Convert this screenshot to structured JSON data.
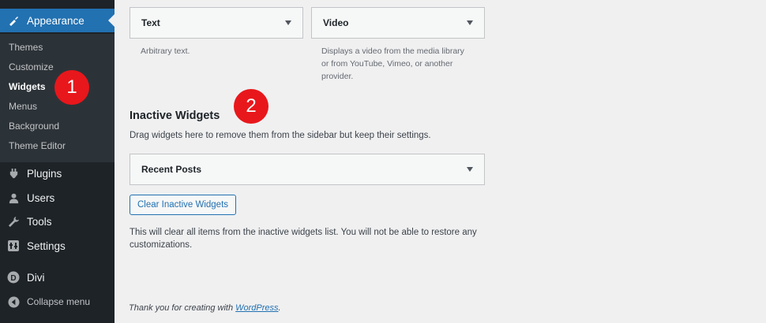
{
  "sidebar": {
    "appearance": {
      "label": "Appearance",
      "icon": "paintbrush-icon"
    },
    "submenu": [
      {
        "label": "Themes"
      },
      {
        "label": "Customize"
      },
      {
        "label": "Widgets"
      },
      {
        "label": "Menus"
      },
      {
        "label": "Background"
      },
      {
        "label": "Theme Editor"
      }
    ],
    "items": [
      {
        "label": "Plugins",
        "icon": "plugin-icon"
      },
      {
        "label": "Users",
        "icon": "user-icon"
      },
      {
        "label": "Tools",
        "icon": "wrench-icon"
      },
      {
        "label": "Settings",
        "icon": "settings-icon"
      },
      {
        "label": "Divi",
        "icon": "divi-icon"
      }
    ],
    "collapse_label": "Collapse menu"
  },
  "widgets": {
    "text": {
      "title": "Text",
      "description": "Arbitrary text."
    },
    "video": {
      "title": "Video",
      "description_lines": [
        "Displays a video from the media library",
        "or from YouTube, Vimeo, or another",
        "provider."
      ]
    }
  },
  "inactive": {
    "title": "Inactive Widgets",
    "description": "Drag widgets here to remove them from the sidebar but keep their settings.",
    "recent_posts": "Recent Posts",
    "clear_button": "Clear Inactive Widgets",
    "clear_note": "This will clear all items from the inactive widgets list. You will not be able to restore any customizations."
  },
  "badges": {
    "one": "1",
    "two": "2"
  },
  "footer": {
    "text": "Thank you for creating with ",
    "link": "WordPress",
    "end": "."
  },
  "colors": {
    "accent": "#2271b1",
    "sidebar": "#1d2327",
    "badge": "#e8171c"
  }
}
